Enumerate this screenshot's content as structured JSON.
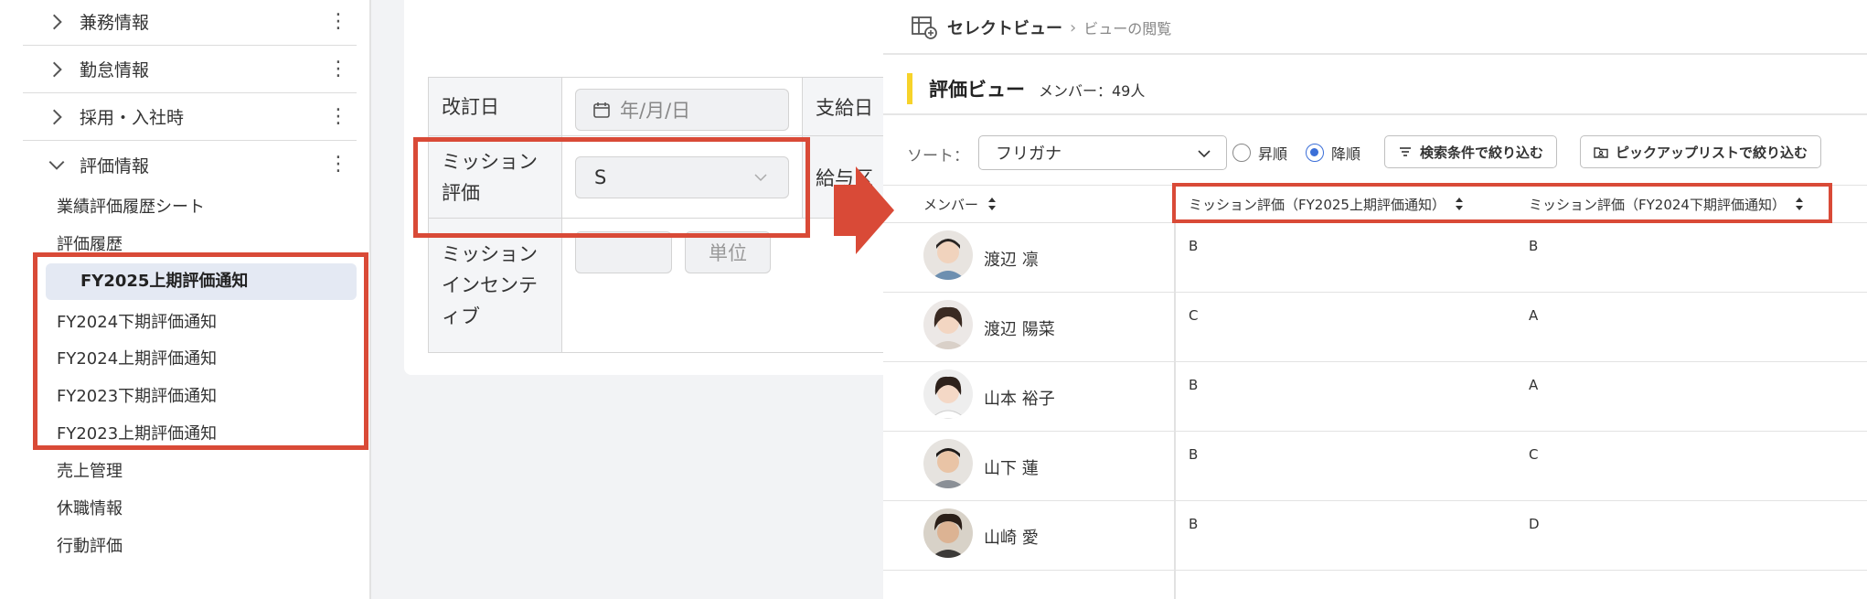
{
  "sidebar": {
    "accordions": [
      {
        "label": "兼務情報",
        "expanded": false
      },
      {
        "label": "勤怠情報",
        "expanded": false
      },
      {
        "label": "採用・入社時",
        "expanded": false
      },
      {
        "label": "評価情報",
        "expanded": true
      }
    ],
    "kebab": "⋮",
    "items": [
      {
        "label": "業績評価履歴シート"
      },
      {
        "label": "評価履歴"
      },
      {
        "label": "FY2025上期評価通知",
        "active": true
      },
      {
        "label": "FY2024下期評価通知"
      },
      {
        "label": "FY2024上期評価通知"
      },
      {
        "label": "FY2023下期評価通知"
      },
      {
        "label": "FY2023上期評価通知"
      },
      {
        "label": "売上管理"
      },
      {
        "label": "休職情報"
      },
      {
        "label": "行動評価"
      }
    ]
  },
  "form": {
    "revision_label": "改訂日",
    "date_placeholder": "年/月/日",
    "payday_label": "支給日",
    "mission_label": "ミッション評価",
    "mission_value": "S",
    "salary_label": "給与区",
    "incentive_label": "ミッションインセンティブ",
    "unit_label": "単位"
  },
  "right": {
    "breadcrumb": {
      "root": "セレクトビュー",
      "current": "ビューの閲覧"
    },
    "title": "評価ビュー",
    "member_count": "メンバー：49人",
    "sort_label": "ソート：",
    "sort_value": "フリガナ",
    "radio_asc": "昇順",
    "radio_desc": "降順",
    "radio_selected": "desc",
    "filter_button": "検索条件で絞り込む",
    "pickup_button": "ピックアップリストで絞り込む",
    "columns": [
      "メンバー",
      "ミッション評価（FY2025上期評価通知）",
      "ミッション評価（FY2024下期評価通知）"
    ],
    "rows": [
      {
        "name": "渡辺 凛",
        "c1": "B",
        "c2": "B"
      },
      {
        "name": "渡辺 陽菜",
        "c1": "C",
        "c2": "A"
      },
      {
        "name": "山本 裕子",
        "c1": "B",
        "c2": "A"
      },
      {
        "name": "山下 蓮",
        "c1": "B",
        "c2": "C"
      },
      {
        "name": "山崎 愛",
        "c1": "B",
        "c2": "D"
      }
    ]
  },
  "colors": {
    "highlight": "#d94a37",
    "accent": "#3b6fd8",
    "title_bar": "#f7d32a"
  }
}
